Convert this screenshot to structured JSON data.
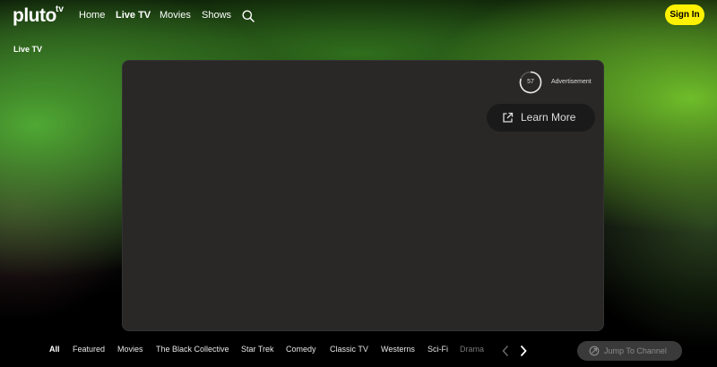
{
  "header": {
    "logo_text": "pluto",
    "logo_tv": "tv",
    "nav": [
      {
        "label": "Home",
        "active": false
      },
      {
        "label": "Live TV",
        "active": true
      },
      {
        "label": "Movies",
        "active": false
      },
      {
        "label": "Shows",
        "active": false
      }
    ],
    "search_icon": "search-icon",
    "signin_label": "Sign In"
  },
  "section_title": "Live TV",
  "player": {
    "countdown": "57",
    "ad_label": "Advertisement",
    "learn_more_label": "Learn More",
    "learn_more_icon": "external-link-icon"
  },
  "categories": [
    "All",
    "Featured",
    "Movies",
    "The Black Collective",
    "Star Trek",
    "Comedy",
    "Classic TV",
    "Westerns",
    "Sci-Fi",
    "Drama"
  ],
  "active_category": "All",
  "jump_label": "Jump To Channel",
  "colors": {
    "accent": "#fff200",
    "glow_green": "#52b035",
    "player_bg": "#292827",
    "jump_bg": "#3a3a3a"
  }
}
